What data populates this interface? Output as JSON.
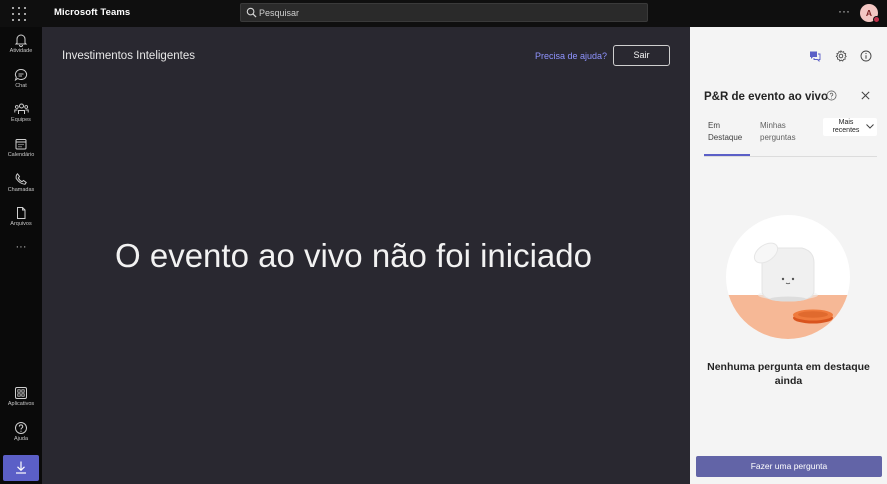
{
  "app": {
    "title": "Microsoft Teams",
    "user_initial": "A"
  },
  "search": {
    "placeholder": "Pesquisar"
  },
  "rail": {
    "items": [
      {
        "label": "Atividade",
        "icon": "bell-icon"
      },
      {
        "label": "Chat",
        "icon": "chat-icon"
      },
      {
        "label": "Equipes",
        "icon": "teams-icon"
      },
      {
        "label": "Calendário",
        "icon": "calendar-icon"
      },
      {
        "label": "Chamadas",
        "icon": "phone-icon"
      },
      {
        "label": "Arquivos",
        "icon": "file-icon"
      }
    ],
    "more": "···",
    "bottom": [
      {
        "label": "Aplicativos",
        "icon": "apps-icon"
      },
      {
        "label": "Ajuda",
        "icon": "help-icon"
      }
    ],
    "download_icon": "download-icon"
  },
  "stage": {
    "event_title": "Investimentos Inteligentes",
    "help_link": "Precisa de ajuda?",
    "leave_button": "Sair",
    "status": "O evento ao vivo não foi iniciado"
  },
  "qa_panel": {
    "title": "P&R de evento ao vivo",
    "tabs": [
      {
        "label_line1": "Em",
        "label_line2": "Destaque",
        "active": true
      },
      {
        "label_line1": "Minhas",
        "label_line2": "perguntas",
        "active": false
      }
    ],
    "sort": {
      "line1": "Mais",
      "line2": "recentes"
    },
    "empty_text": "Nenhuma pergunta em destaque ainda",
    "ask_button": "Fazer uma pergunta"
  },
  "colors": {
    "accent": "#5b5fc7",
    "ask_button": "#6264a7",
    "stage_bg": "#292830",
    "panel_bg": "#f4f4f4"
  },
  "top_more": "···"
}
